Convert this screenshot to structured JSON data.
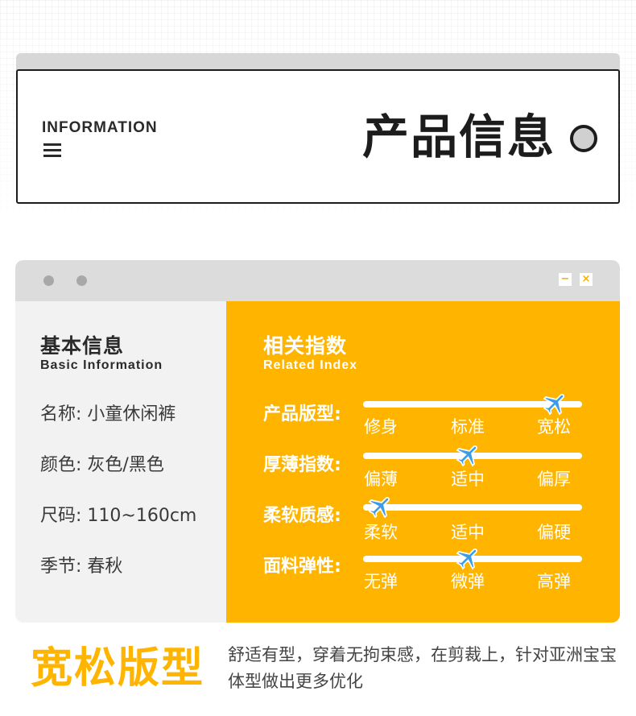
{
  "header": {
    "info_label": "INFORMATION",
    "title": "产品信息"
  },
  "window": {
    "min_symbol": "−",
    "close_symbol": "×",
    "left": {
      "title": "基本信息",
      "subtitle": "Basic Information",
      "lines": [
        "名称: 小童休闲裤",
        "颜色: 灰色/黑色",
        "尺码: 110~160cm",
        "季节: 春秋"
      ]
    },
    "right": {
      "title": "相关指数",
      "subtitle": "Related Index",
      "indexes": [
        {
          "label": "产品版型:",
          "scale": [
            "修身",
            "标准",
            "宽松"
          ],
          "level": 0.88
        },
        {
          "label": "厚薄指数:",
          "scale": [
            "偏薄",
            "适中",
            "偏厚"
          ],
          "level": 0.48
        },
        {
          "label": "柔软质感:",
          "scale": [
            "柔软",
            "适中",
            "偏硬"
          ],
          "level": 0.08
        },
        {
          "label": "面料弹性:",
          "scale": [
            "无弹",
            "微弹",
            "高弹"
          ],
          "level": 0.48
        }
      ]
    }
  },
  "feature": {
    "title": "宽松版型",
    "description": "舒适有型，穿着无拘束感，在剪裁上，针对亚洲宝宝体型做出更多优化"
  },
  "colors": {
    "accent": "#ffb500",
    "dark": "#1c1c1c",
    "plane": "#3d9be8"
  }
}
